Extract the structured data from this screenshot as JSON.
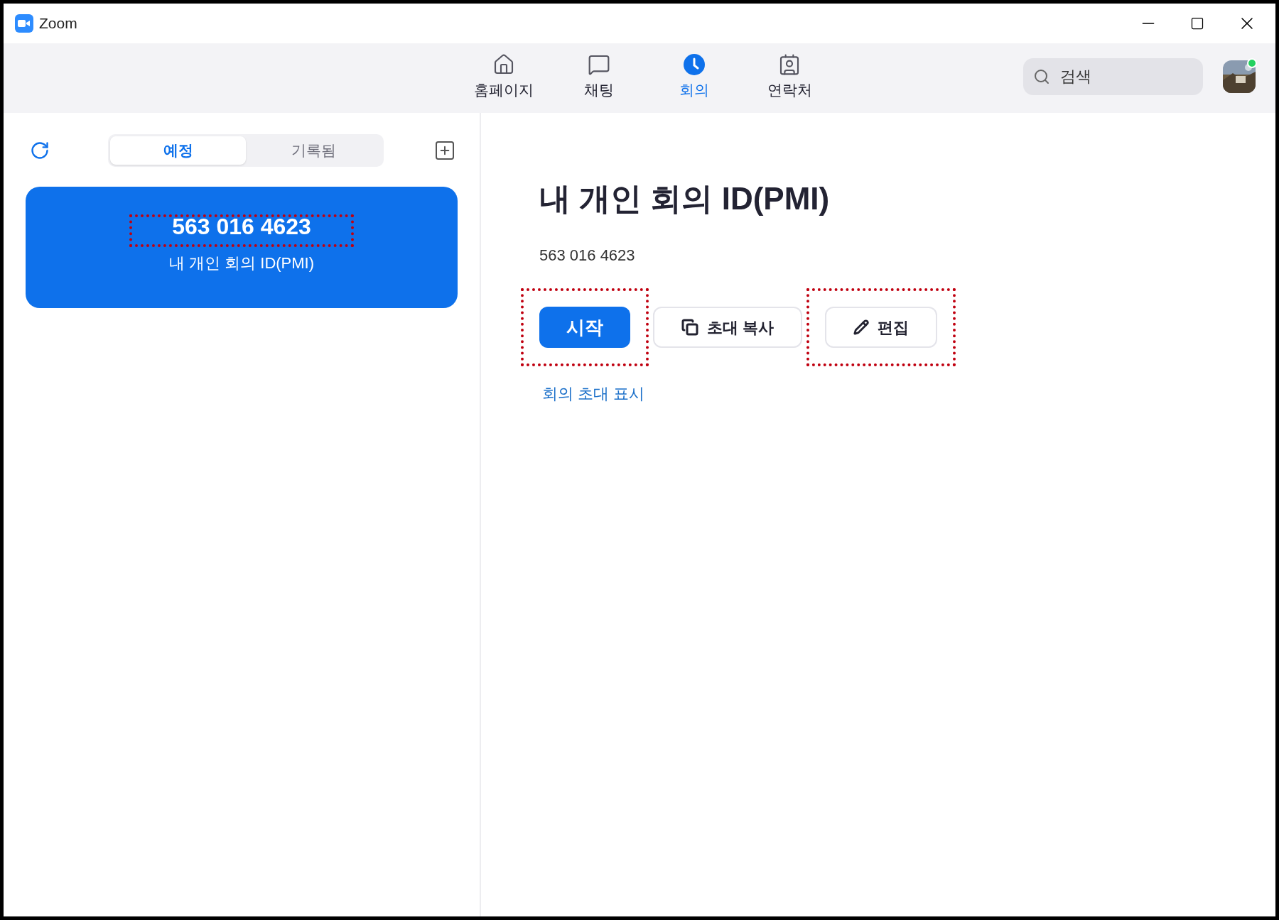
{
  "window": {
    "title": "Zoom"
  },
  "nav": [
    {
      "label": "홈페이지",
      "selected": false
    },
    {
      "label": "채팅",
      "selected": false
    },
    {
      "label": "회의",
      "selected": true
    },
    {
      "label": "연락처",
      "selected": false
    }
  ],
  "search": {
    "placeholder": "검색"
  },
  "user": {
    "online": true
  },
  "meeting_tabs": [
    {
      "label": "예정",
      "selected": true
    },
    {
      "label": "기록됨",
      "selected": false
    }
  ],
  "meetings": [
    {
      "number": "563 016 4623",
      "name": "내 개인 회의 ID(PMI)",
      "selected": true,
      "highlighted": true
    }
  ],
  "detail": {
    "title": "내 개인 회의 ID(PMI)",
    "number": "563 016 4623",
    "buttons": [
      {
        "label": "시작",
        "kind": "primary",
        "highlighted": true
      },
      {
        "label": "초대 복사",
        "kind": "copy",
        "highlighted": false
      },
      {
        "label": "편집",
        "kind": "edit",
        "highlighted": true
      }
    ],
    "link": "회의 초대 표시"
  }
}
